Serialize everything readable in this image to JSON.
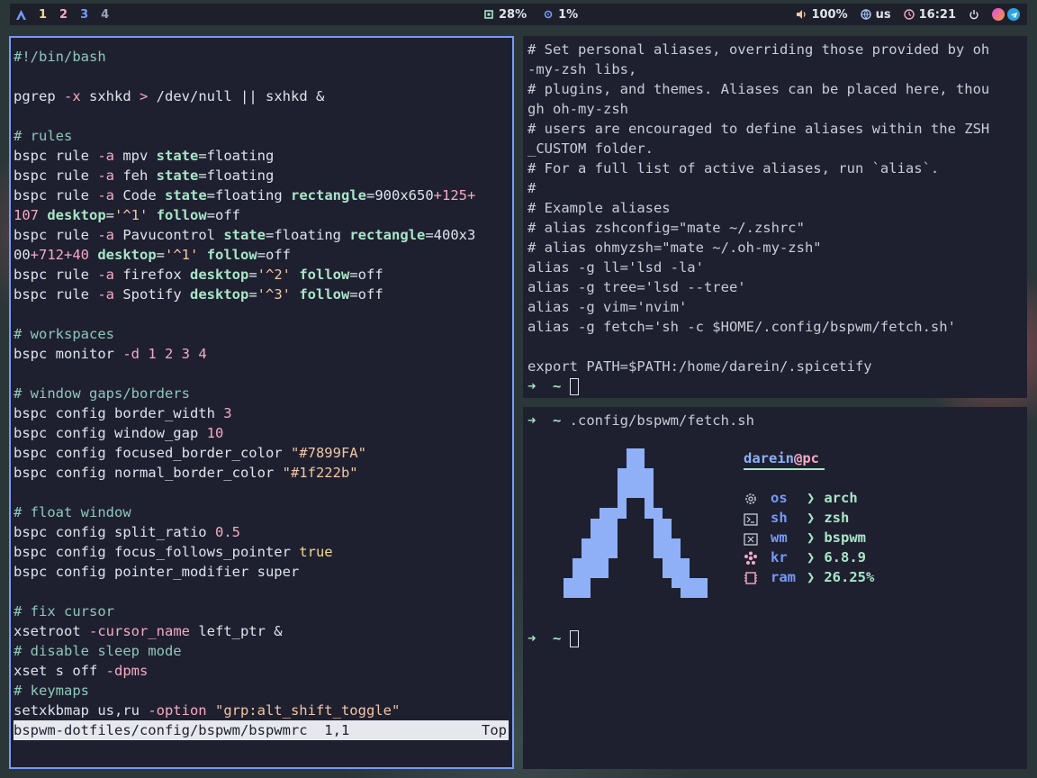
{
  "topbar": {
    "logo_icon": "arch-logo-icon",
    "workspaces": [
      {
        "label": "1",
        "color": "#f5d98c"
      },
      {
        "label": "2",
        "color": "#f7aac1"
      },
      {
        "label": "3",
        "color": "#7899fa"
      },
      {
        "label": "4",
        "color": "#9aa3b8"
      }
    ],
    "memory": "28%",
    "cpu": "1%",
    "volume": "100%",
    "keyboard_layout": "us",
    "clock": "16:21"
  },
  "editor": {
    "lines": [
      [
        {
          "t": "#!/bin/bash",
          "c": "cm"
        }
      ],
      [],
      [
        {
          "t": "pgrep ",
          "c": "kw"
        },
        {
          "t": "-x",
          "c": "op"
        },
        {
          "t": " sxhkd ",
          "c": "kw"
        },
        {
          "t": ">",
          "c": "op"
        },
        {
          "t": " /dev/null || sxhkd &",
          "c": "kw"
        }
      ],
      [],
      [
        {
          "t": "# rules",
          "c": "cm"
        }
      ],
      [
        {
          "t": "bspc rule ",
          "c": "kw"
        },
        {
          "t": "-a",
          "c": "op"
        },
        {
          "t": " mpv ",
          "c": "kw"
        },
        {
          "t": "state",
          "c": "key"
        },
        {
          "t": "=floating",
          "c": "kw"
        }
      ],
      [
        {
          "t": "bspc rule ",
          "c": "kw"
        },
        {
          "t": "-a",
          "c": "op"
        },
        {
          "t": " feh ",
          "c": "kw"
        },
        {
          "t": "state",
          "c": "key"
        },
        {
          "t": "=floating",
          "c": "kw"
        }
      ],
      [
        {
          "t": "bspc rule ",
          "c": "kw"
        },
        {
          "t": "-a",
          "c": "op"
        },
        {
          "t": " Code ",
          "c": "kw"
        },
        {
          "t": "state",
          "c": "key"
        },
        {
          "t": "=floating ",
          "c": "kw"
        },
        {
          "t": "rectangle",
          "c": "key"
        },
        {
          "t": "=900x650",
          "c": "kw"
        },
        {
          "t": "+125+",
          "c": "num"
        }
      ],
      [
        {
          "t": "107",
          "c": "num"
        },
        {
          "t": " ",
          "c": "kw"
        },
        {
          "t": "desktop",
          "c": "key"
        },
        {
          "t": "=",
          "c": "kw"
        },
        {
          "t": "'^1'",
          "c": "str"
        },
        {
          "t": " ",
          "c": "kw"
        },
        {
          "t": "follow",
          "c": "key"
        },
        {
          "t": "=off",
          "c": "kw"
        }
      ],
      [
        {
          "t": "bspc rule ",
          "c": "kw"
        },
        {
          "t": "-a",
          "c": "op"
        },
        {
          "t": " Pavucontrol ",
          "c": "kw"
        },
        {
          "t": "state",
          "c": "key"
        },
        {
          "t": "=floating ",
          "c": "kw"
        },
        {
          "t": "rectangle",
          "c": "key"
        },
        {
          "t": "=400x3",
          "c": "kw"
        }
      ],
      [
        {
          "t": "00",
          "c": "kw"
        },
        {
          "t": "+712+40",
          "c": "num"
        },
        {
          "t": " ",
          "c": "kw"
        },
        {
          "t": "desktop",
          "c": "key"
        },
        {
          "t": "=",
          "c": "kw"
        },
        {
          "t": "'^1'",
          "c": "str"
        },
        {
          "t": " ",
          "c": "kw"
        },
        {
          "t": "follow",
          "c": "key"
        },
        {
          "t": "=off",
          "c": "kw"
        }
      ],
      [
        {
          "t": "bspc rule ",
          "c": "kw"
        },
        {
          "t": "-a",
          "c": "op"
        },
        {
          "t": " firefox ",
          "c": "kw"
        },
        {
          "t": "desktop",
          "c": "key"
        },
        {
          "t": "=",
          "c": "kw"
        },
        {
          "t": "'^2'",
          "c": "str"
        },
        {
          "t": " ",
          "c": "kw"
        },
        {
          "t": "follow",
          "c": "key"
        },
        {
          "t": "=off",
          "c": "kw"
        }
      ],
      [
        {
          "t": "bspc rule ",
          "c": "kw"
        },
        {
          "t": "-a",
          "c": "op"
        },
        {
          "t": " Spotify ",
          "c": "kw"
        },
        {
          "t": "desktop",
          "c": "key"
        },
        {
          "t": "=",
          "c": "kw"
        },
        {
          "t": "'^3'",
          "c": "str"
        },
        {
          "t": " ",
          "c": "kw"
        },
        {
          "t": "follow",
          "c": "key"
        },
        {
          "t": "=off",
          "c": "kw"
        }
      ],
      [],
      [
        {
          "t": "# workspaces",
          "c": "cm"
        }
      ],
      [
        {
          "t": "bspc monitor ",
          "c": "kw"
        },
        {
          "t": "-d",
          "c": "op"
        },
        {
          "t": " 1 2 3 4",
          "c": "num"
        }
      ],
      [],
      [
        {
          "t": "# window gaps/borders",
          "c": "cm"
        }
      ],
      [
        {
          "t": "bspc config border_width ",
          "c": "kw"
        },
        {
          "t": "3",
          "c": "num"
        }
      ],
      [
        {
          "t": "bspc config window_gap ",
          "c": "kw"
        },
        {
          "t": "10",
          "c": "num"
        }
      ],
      [
        {
          "t": "bspc config focused_border_color ",
          "c": "kw"
        },
        {
          "t": "\"#7899FA\"",
          "c": "str"
        }
      ],
      [
        {
          "t": "bspc config normal_border_color ",
          "c": "kw"
        },
        {
          "t": "\"#1f222b\"",
          "c": "str"
        }
      ],
      [],
      [
        {
          "t": "# float window",
          "c": "cm"
        }
      ],
      [
        {
          "t": "bspc config split_ratio ",
          "c": "kw"
        },
        {
          "t": "0.5",
          "c": "num"
        }
      ],
      [
        {
          "t": "bspc config focus_follows_pointer ",
          "c": "kw"
        },
        {
          "t": "true",
          "c": "tru"
        }
      ],
      [
        {
          "t": "bspc config pointer_modifier super",
          "c": "kw"
        }
      ],
      [],
      [
        {
          "t": "# fix cursor",
          "c": "cm"
        }
      ],
      [
        {
          "t": "xsetroot ",
          "c": "kw"
        },
        {
          "t": "-cursor_name",
          "c": "op"
        },
        {
          "t": " left_ptr &",
          "c": "kw"
        }
      ],
      [
        {
          "t": "# disable sleep mode",
          "c": "cm"
        }
      ],
      [
        {
          "t": "xset s off ",
          "c": "kw"
        },
        {
          "t": "-dpms",
          "c": "op"
        }
      ],
      [
        {
          "t": "# keymaps",
          "c": "cm"
        }
      ],
      [
        {
          "t": "setxkbmap us,ru ",
          "c": "kw"
        },
        {
          "t": "-option",
          "c": "op"
        },
        {
          "t": " ",
          "c": "kw"
        },
        {
          "t": "\"grp:alt_shift_toggle\"",
          "c": "str"
        }
      ]
    ],
    "status_file": "bspwm-dotfiles/config/bspwm/bspwmrc",
    "status_pos": "1,1",
    "status_scroll": "Top"
  },
  "zshrc": {
    "lines": [
      "# Set personal aliases, overriding those provided by oh",
      "-my-zsh libs,",
      "# plugins, and themes. Aliases can be placed here, thou",
      "gh oh-my-zsh",
      "# users are encouraged to define aliases within the ZSH",
      "_CUSTOM folder.",
      "# For a full list of active aliases, run `alias`.",
      "#",
      "# Example aliases",
      "# alias zshconfig=\"mate ~/.zshrc\"",
      "# alias ohmyzsh=\"mate ~/.oh-my-zsh\"",
      "alias -g ll='lsd -la'",
      "alias -g tree='lsd --tree'",
      "alias -g vim='nvim'",
      "alias -g fetch='sh -c $HOME/.config/bspwm/fetch.sh'",
      "",
      "export PATH=$PATH:/home/darein/.spicetify"
    ],
    "prompt": "➜  ~"
  },
  "fetch": {
    "command_prompt": "➜  ~",
    "command": ".config/bspwm/fetch.sh",
    "user": "darein",
    "at": "@",
    "host": "pc",
    "info": [
      {
        "icon": "gear-icon",
        "label": "os",
        "value": "arch"
      },
      {
        "icon": "terminal-icon",
        "label": "sh",
        "value": "zsh"
      },
      {
        "icon": "window-icon",
        "label": "wm",
        "value": "bspwm"
      },
      {
        "icon": "kernel-icon",
        "label": "kr",
        "value": "6.8.9"
      },
      {
        "icon": "chip-icon",
        "label": "ram",
        "value": "26.25%"
      }
    ],
    "arrow": "❯",
    "prompt": "➜  ~"
  }
}
